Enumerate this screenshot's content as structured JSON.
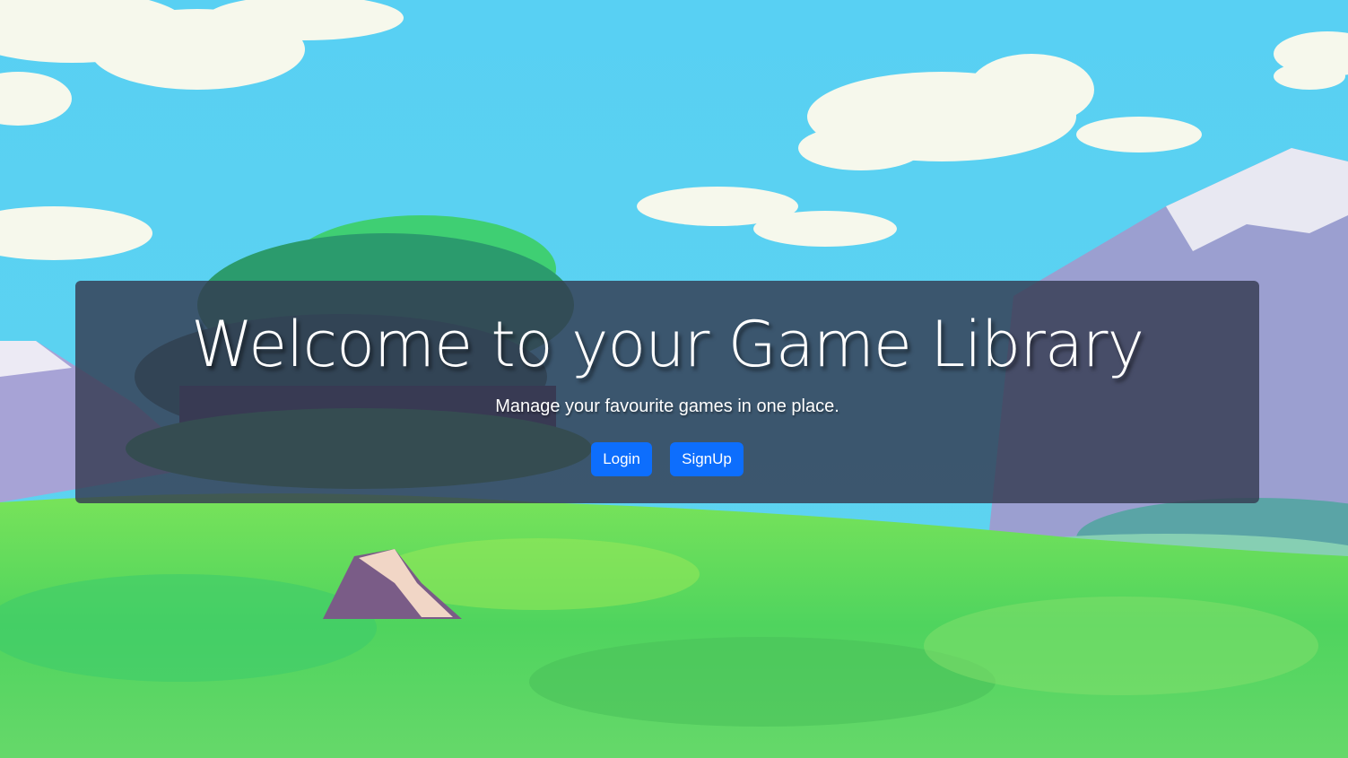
{
  "hero": {
    "title": "Welcome to your Game Library",
    "subtitle": "Manage your favourite games in one place."
  },
  "actions": {
    "login_label": "Login",
    "signup_label": "SignUp"
  },
  "colors": {
    "sky": "#55cdef",
    "primary_button": "#0d6efd",
    "panel_overlay": "rgba(52,58,80,0.82)",
    "grass": "#5fd35a"
  }
}
